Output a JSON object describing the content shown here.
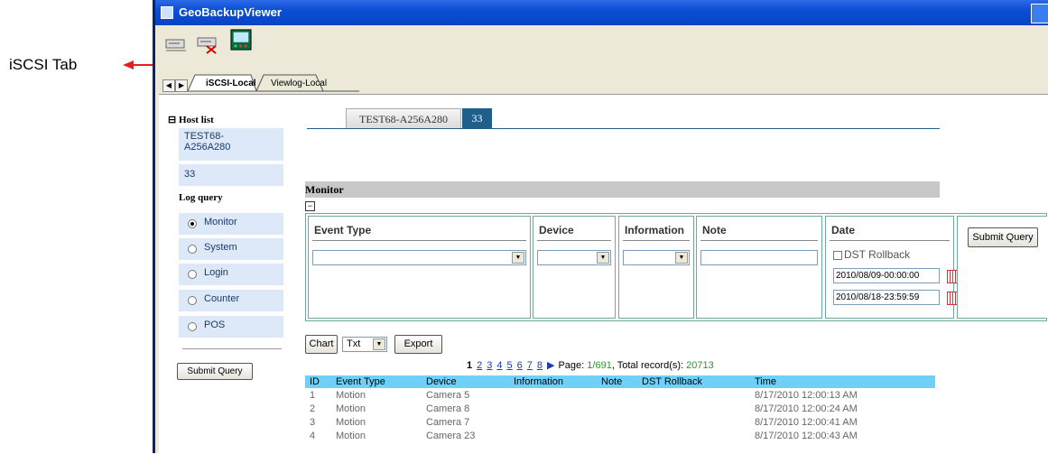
{
  "annotation": {
    "label": "iSCSI Tab"
  },
  "window": {
    "title": "GeoBackupViewer"
  },
  "toolbar": {
    "icons": [
      "connect-icon",
      "disconnect-icon",
      "viewlog-icon"
    ]
  },
  "tabs": [
    {
      "label": "iSCSI-Local",
      "active": true
    },
    {
      "label": "Viewlog-Local",
      "active": false
    }
  ],
  "sidebar": {
    "host_list_title": "Host list",
    "hosts": [
      "TEST68-A256A280",
      "33"
    ],
    "log_query_title": "Log query",
    "log_options": [
      {
        "label": "Monitor",
        "selected": true
      },
      {
        "label": "System",
        "selected": false
      },
      {
        "label": "Login",
        "selected": false
      },
      {
        "label": "Counter",
        "selected": false
      },
      {
        "label": "POS",
        "selected": false
      }
    ],
    "submit_label": "Submit Query"
  },
  "host_tabs": [
    {
      "label": "TEST68-A256A280",
      "active": false
    },
    {
      "label": "33",
      "active": true
    }
  ],
  "monitor": {
    "title": "Monitor",
    "event_type_label": "Event Type",
    "device_label": "Device",
    "information_label": "Information",
    "note_label": "Note",
    "date_label": "Date",
    "dst_rollback_label": "DST Rollback",
    "start_date": "2010/08/09-00:00:00",
    "end_date": "2010/08/18-23:59:59",
    "submit_label": "Submit Query"
  },
  "actions": {
    "chart_label": "Chart",
    "format_value": "Txt",
    "export_label": "Export"
  },
  "pagination": {
    "pages": [
      "1",
      "2",
      "3",
      "4",
      "5",
      "6",
      "7",
      "8"
    ],
    "page_prefix": "Page: ",
    "current_page": "1/691",
    "records_prefix": ", Total record(s): ",
    "total_records": "20713"
  },
  "results": {
    "columns": [
      "ID",
      "Event Type",
      "Device",
      "Information",
      "Note",
      "DST Rollback",
      "Time"
    ],
    "rows": [
      [
        "1",
        "Motion",
        "Camera 5",
        "",
        "",
        "",
        "8/17/2010 12:00:13 AM"
      ],
      [
        "2",
        "Motion",
        "Camera 8",
        "",
        "",
        "",
        "8/17/2010 12:00:24 AM"
      ],
      [
        "3",
        "Motion",
        "Camera 7",
        "",
        "",
        "",
        "8/17/2010 12:00:41 AM"
      ],
      [
        "4",
        "Motion",
        "Camera 23",
        "",
        "",
        "",
        "8/17/2010 12:00:43 AM"
      ]
    ]
  },
  "colors": {
    "titlebar": "#0a4fd4",
    "table_header": "#6fd1f7",
    "sidebar_item": "#dde9f8",
    "active_tab": "#1f5f8b",
    "annotation_arrow": "#e02020"
  }
}
